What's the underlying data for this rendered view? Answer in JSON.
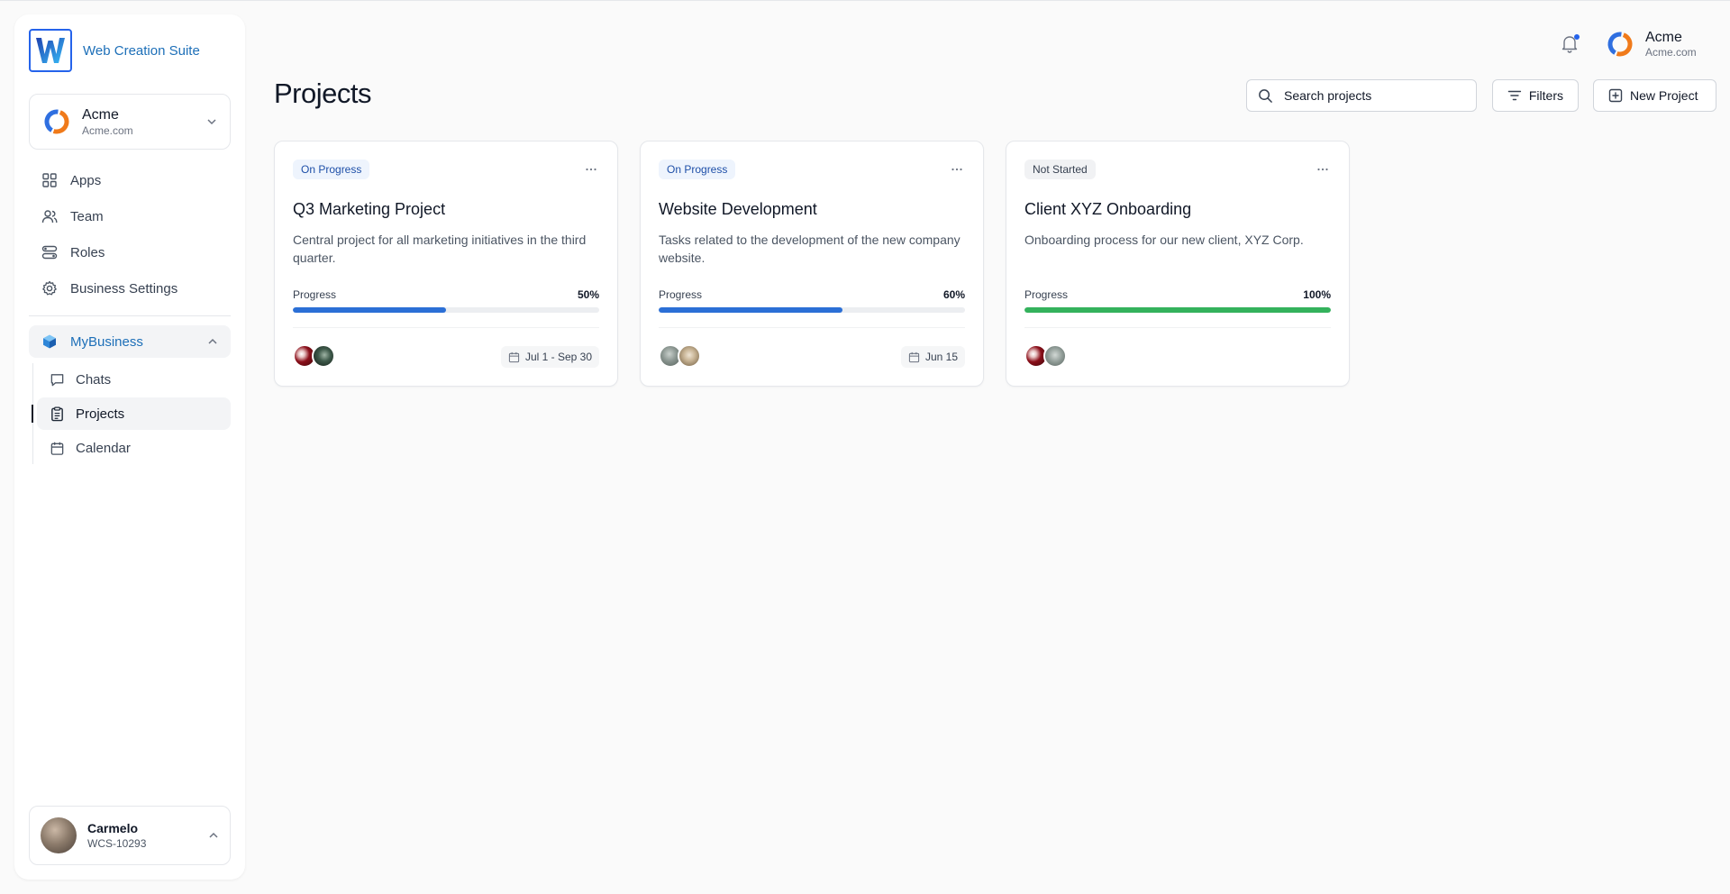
{
  "brand": {
    "name": "Web Creation Suite",
    "logo_letter": "W"
  },
  "org": {
    "name": "Acme",
    "domain": "Acme.com"
  },
  "nav": {
    "items": [
      {
        "label": "Apps",
        "icon": "apps-grid-icon"
      },
      {
        "label": "Team",
        "icon": "team-icon"
      },
      {
        "label": "Roles",
        "icon": "roles-icon"
      },
      {
        "label": "Business Settings",
        "icon": "gear-icon"
      }
    ],
    "group": {
      "label": "MyBusiness",
      "icon": "cube-icon",
      "expanded": true,
      "children": [
        {
          "label": "Chats",
          "icon": "chat-icon"
        },
        {
          "label": "Projects",
          "icon": "clipboard-icon",
          "active": true
        },
        {
          "label": "Calendar",
          "icon": "calendar-icon"
        }
      ]
    }
  },
  "user": {
    "name": "Carmelo",
    "id": "WCS-10293"
  },
  "header": {
    "account_name": "Acme",
    "account_domain": "Acme.com",
    "notifications_unread": true
  },
  "page": {
    "title": "Projects",
    "search_placeholder": "Search projects",
    "filters_label": "Filters",
    "new_project_label": "New Project"
  },
  "projects": [
    {
      "status": "On Progress",
      "title": "Q3 Marketing Project",
      "description": "Central project for all marketing initiatives in the third quarter.",
      "progress_label": "Progress",
      "progress_text": "50%",
      "progress": 0.5,
      "progress_color": "#2b6fd6",
      "date": "Jul 1 - Sep 30"
    },
    {
      "status": "On Progress",
      "title": "Website Development",
      "description": "Tasks related to the development of the new company website.",
      "progress_label": "Progress",
      "progress_text": "60%",
      "progress": 0.6,
      "progress_color": "#2b6fd6",
      "date": "Jun 15"
    },
    {
      "status": "Not Started",
      "title": "Client XYZ Onboarding",
      "description": "Onboarding process for our new client, XYZ Corp.",
      "progress_label": "Progress",
      "progress_text": "100%",
      "progress": 1.0,
      "progress_color": "#34b25c",
      "date": ""
    }
  ],
  "colors": {
    "accent": "#1d6fb8",
    "progress_blue": "#2b6fd6",
    "progress_green": "#34b25c"
  }
}
